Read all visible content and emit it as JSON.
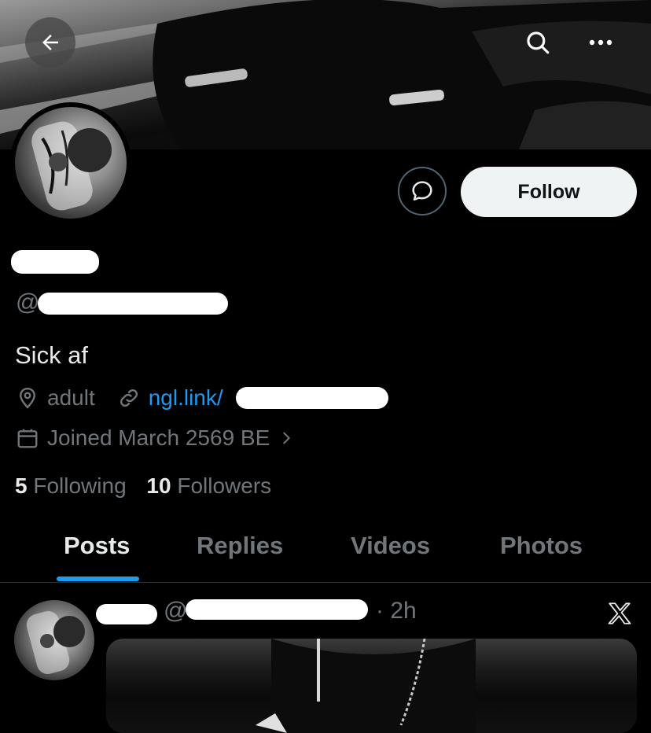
{
  "header": {
    "back_icon": "arrow-left-icon",
    "search_icon": "search-icon",
    "more_icon": "more-horizontal-icon"
  },
  "profile": {
    "handle_prefix": "@",
    "bio": "Sick af",
    "location": "adult",
    "link": "ngl.link/",
    "joined": "Joined March 2569 BE",
    "following_count": "5",
    "following_label": "Following",
    "followers_count": "10",
    "followers_label": "Followers"
  },
  "actions": {
    "follow_label": "Follow",
    "message_icon": "message-bubble-icon"
  },
  "tabs": [
    {
      "label": "Posts",
      "active": true
    },
    {
      "label": "Replies",
      "active": false
    },
    {
      "label": "Videos",
      "active": false
    },
    {
      "label": "Photos",
      "active": false
    }
  ],
  "post": {
    "handle_prefix": "@",
    "time": "· 2h",
    "source_icon": "x-logo-icon"
  },
  "colors": {
    "accent": "#1d9bf0",
    "background": "#000000",
    "muted": "#71767b",
    "follow_button_bg": "#eff3f4"
  }
}
